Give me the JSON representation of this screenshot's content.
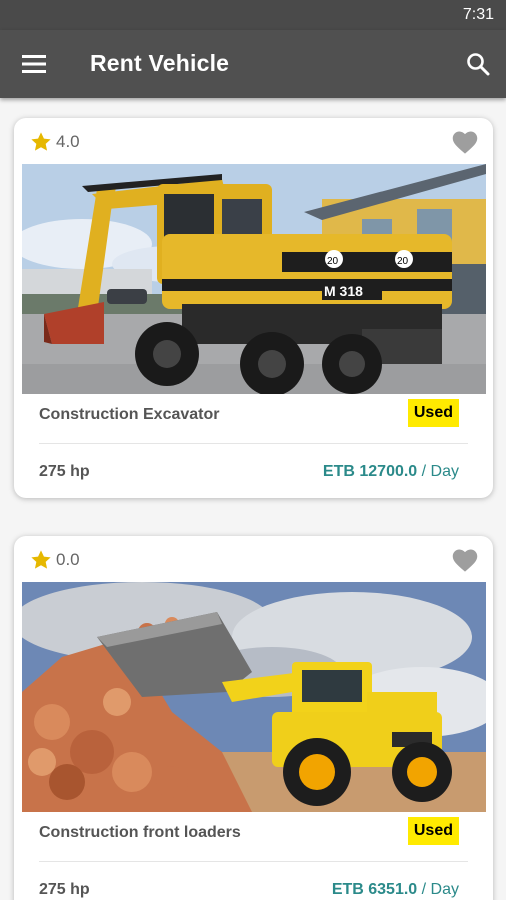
{
  "status_bar": {
    "time": "7:31"
  },
  "app_bar": {
    "title": "Rent Vehicle"
  },
  "vehicles": [
    {
      "rating": "4.0",
      "name": "Construction Excavator",
      "condition": "Used",
      "power": "275 hp",
      "price": "ETB 12700.0",
      "price_unit": "/ Day",
      "photo_text_1": "M 318",
      "photo_text_2": "20",
      "photo_text_3": "20"
    },
    {
      "rating": "0.0",
      "name": "Construction front loaders",
      "condition": "Used",
      "power": "275 hp",
      "price": "ETB 6351.0",
      "price_unit": "/ Day"
    }
  ],
  "colors": {
    "app_bar": "#505050",
    "status_bar": "#4a4a4a",
    "star": "#e6b800",
    "price": "#2b8a8a",
    "badge": "#ffea00"
  }
}
